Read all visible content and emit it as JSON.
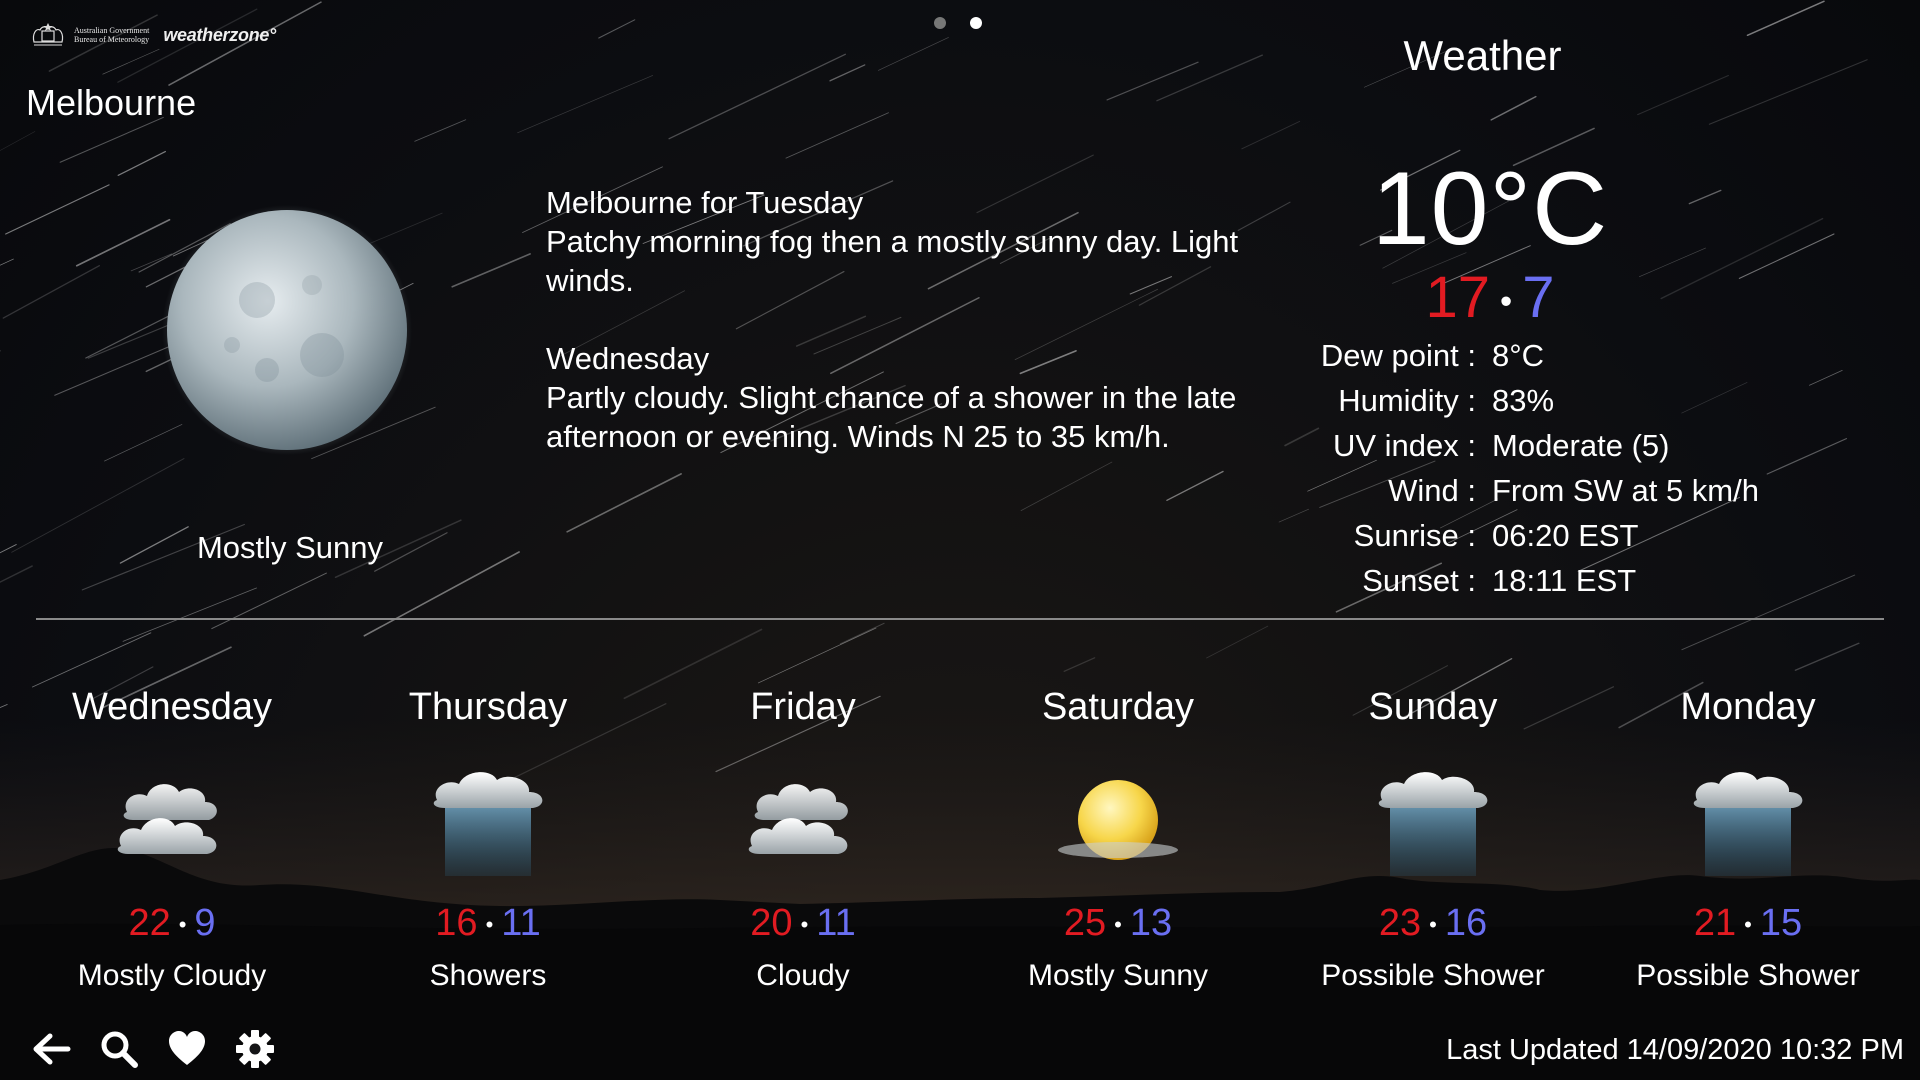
{
  "header": {
    "gov_logo_text": [
      "Australian Government",
      "Bureau of Meteorology"
    ],
    "brand": "weatherzone°",
    "pager": {
      "count": 2,
      "active": 2
    }
  },
  "location": "Melbourne",
  "today": {
    "icon": "moon-icon",
    "condition": "Mostly Sunny"
  },
  "forecast_text": {
    "block1_title": "Melbourne for Tuesday",
    "block1_body": "Patchy morning fog then a mostly sunny day. Light winds.",
    "block2_title": "Wednesday",
    "block2_body": "Partly cloudy. Slight chance of a shower in the late afternoon or evening. Winds N 25 to 35 km/h."
  },
  "current": {
    "title": "Weather",
    "temperature": "10°C",
    "high": "17",
    "separator": "•",
    "low": "7",
    "details": [
      {
        "label": "Dew point :",
        "value": "8°C"
      },
      {
        "label": "Humidity :",
        "value": "83%"
      },
      {
        "label": "UV index :",
        "value": "Moderate (5)"
      },
      {
        "label": "Wind :",
        "value": "From SW at 5 km/h"
      },
      {
        "label": "Sunrise :",
        "value": "06:20 EST"
      },
      {
        "label": "Sunset :",
        "value": "18:11 EST"
      }
    ]
  },
  "days": [
    {
      "name": "Wednesday",
      "icon": "cloud-icon",
      "high": "22",
      "low": "9",
      "condition": "Mostly Cloudy"
    },
    {
      "name": "Thursday",
      "icon": "rain-cloud-icon",
      "high": "16",
      "low": "11",
      "condition": "Showers"
    },
    {
      "name": "Friday",
      "icon": "cloud-icon",
      "high": "20",
      "low": "11",
      "condition": "Cloudy"
    },
    {
      "name": "Saturday",
      "icon": "sun-icon",
      "high": "25",
      "low": "13",
      "condition": "Mostly Sunny"
    },
    {
      "name": "Sunday",
      "icon": "rain-cloud-icon",
      "high": "23",
      "low": "16",
      "condition": "Possible Shower"
    },
    {
      "name": "Monday",
      "icon": "rain-cloud-icon",
      "high": "21",
      "low": "15",
      "condition": "Possible Shower"
    }
  ],
  "toolbar": {
    "icons": [
      "back-arrow-icon",
      "search-icon",
      "heart-icon",
      "gear-icon"
    ]
  },
  "last_updated": "Last Updated 14/09/2020 10:32 PM",
  "colors": {
    "high": "#e21b22",
    "low": "#6a6ff2",
    "divider": "#8a8a8a"
  }
}
